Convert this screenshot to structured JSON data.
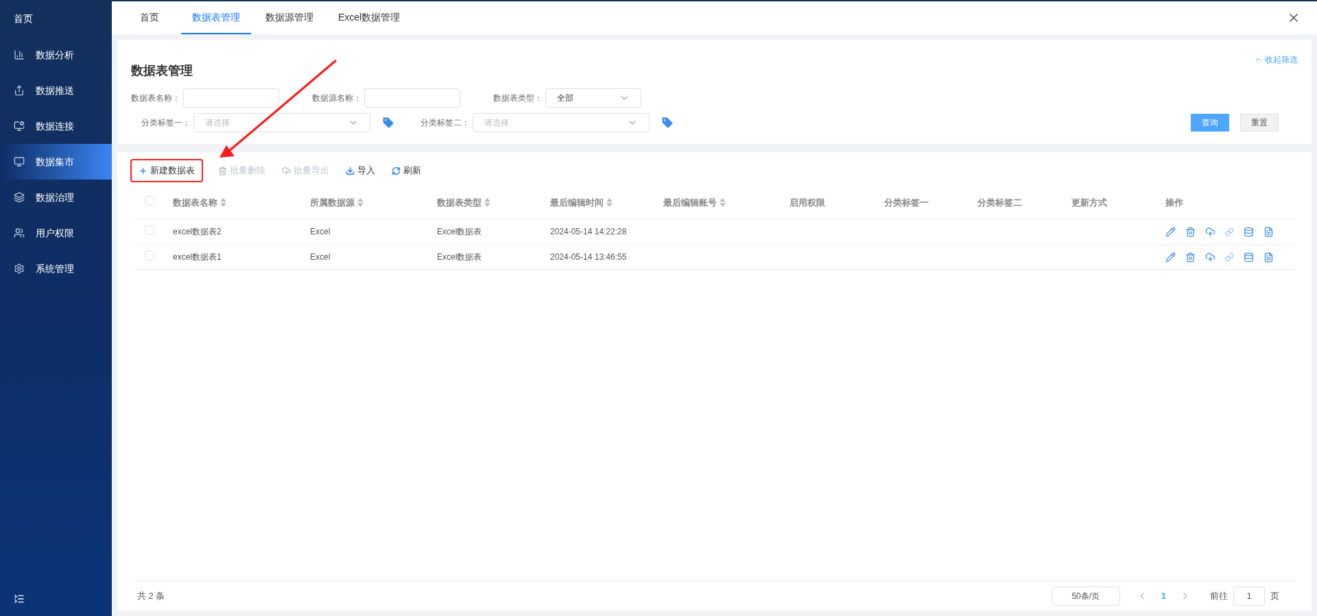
{
  "sidebar": {
    "home": "首页",
    "items": [
      {
        "label": "数据分析",
        "kind": "analysis",
        "selected": false
      },
      {
        "label": "数据推送",
        "kind": "push",
        "selected": false
      },
      {
        "label": "数据连接",
        "kind": "connect",
        "selected": false
      },
      {
        "label": "数据集市",
        "kind": "mart",
        "selected": true
      },
      {
        "label": "数据治理",
        "kind": "govern",
        "selected": false
      },
      {
        "label": "用户权限",
        "kind": "users",
        "selected": false
      },
      {
        "label": "系统管理",
        "kind": "system",
        "selected": false
      }
    ]
  },
  "tabs": [
    {
      "label": "首页",
      "selected": false
    },
    {
      "label": "数据表管理",
      "selected": true
    },
    {
      "label": "数据源管理",
      "selected": false
    },
    {
      "label": "Excel数据管理",
      "selected": false
    }
  ],
  "filters": {
    "title": "数据表管理",
    "collapse_label": "收起筛选",
    "row_1": [
      {
        "label": "数据表名称：",
        "kind": "text"
      },
      {
        "label": "数据源名称：",
        "kind": "text"
      },
      {
        "label": "数据表类型：",
        "kind": "select",
        "value": "全部"
      }
    ],
    "row_2": [
      {
        "label": "分类标签一：",
        "kind": "tag_select",
        "placeholder": "请选择"
      },
      {
        "label": "分类标签二：",
        "kind": "tag_select",
        "placeholder": "请选择"
      }
    ],
    "query_button": "查询",
    "reset_button": "重置"
  },
  "toolbar": [
    {
      "label": "新建数据表",
      "kind": "add",
      "disabled": false,
      "highlighted": true
    },
    {
      "label": "批量删除",
      "kind": "delete",
      "disabled": true,
      "highlighted": false
    },
    {
      "label": "批量导出",
      "kind": "export",
      "disabled": true,
      "highlighted": false
    },
    {
      "label": "导入",
      "kind": "import",
      "disabled": false,
      "highlighted": false
    },
    {
      "label": "刷新",
      "kind": "refresh",
      "disabled": false,
      "highlighted": false
    }
  ],
  "table": {
    "select_all_checked": false,
    "columns": [
      {
        "label": "数据表名称",
        "sortable": true
      },
      {
        "label": "所属数据源",
        "sortable": true
      },
      {
        "label": "数据表类型",
        "sortable": true
      },
      {
        "label": "最后编辑时间",
        "sortable": true
      },
      {
        "label": "最后编辑账号",
        "sortable": true
      },
      {
        "label": "启用权限",
        "sortable": false
      },
      {
        "label": "分类标签一",
        "sortable": false
      },
      {
        "label": "分类标签二",
        "sortable": false
      },
      {
        "label": "更新方式",
        "sortable": false
      },
      {
        "label": "操作",
        "sortable": false
      }
    ],
    "rows": [
      {
        "checked": false,
        "cells": [
          "excel数据表2",
          "Excel",
          "Excel数据表",
          "2024-05-14 14:22:28"
        ]
      },
      {
        "checked": false,
        "cells": [
          "excel数据表1",
          "Excel",
          "Excel数据表",
          "2024-05-14 13:46:55"
        ]
      }
    ]
  },
  "pagination": {
    "total": "共 2 条",
    "page_size": "50条/页",
    "pages": [
      {
        "label": "1",
        "selected": true
      }
    ],
    "goto_label": "前往",
    "goto_value": "1",
    "page_suffix": "页"
  }
}
